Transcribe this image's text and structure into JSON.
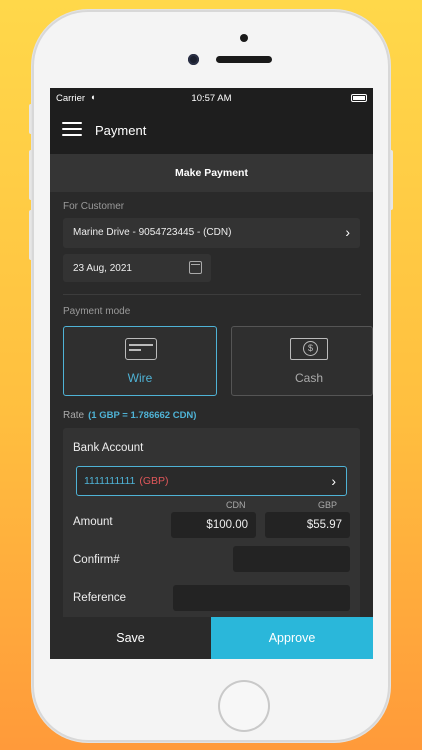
{
  "status_bar": {
    "carrier": "Carrier",
    "time": "10:57 AM"
  },
  "header": {
    "title": "Payment"
  },
  "subheader": {
    "title": "Make Payment"
  },
  "customer": {
    "label": "For Customer",
    "value": "Marine Drive - 9054723445 - (CDN)"
  },
  "date": {
    "value": "23 Aug, 2021"
  },
  "payment_mode": {
    "label": "Payment mode",
    "options": [
      {
        "label": "Wire",
        "selected": true
      },
      {
        "label": "Cash",
        "selected": false
      }
    ]
  },
  "rate": {
    "label": "Rate",
    "value": "(1 GBP = 1.786662 CDN)"
  },
  "bank": {
    "label": "Bank Account",
    "account_number": "1111111111",
    "account_currency": "(GBP)"
  },
  "amount": {
    "label": "Amount",
    "col_cdn": "CDN",
    "col_gbp": "GBP",
    "cdn_value": "$100.00",
    "gbp_value": "$55.97"
  },
  "confirm": {
    "label": "Confirm#",
    "value": ""
  },
  "reference": {
    "label": "Reference",
    "value": ""
  },
  "footer": {
    "save_label": "Save",
    "approve_label": "Approve"
  },
  "colors": {
    "accent": "#2ab7da",
    "currency": "#e0575a",
    "screen_bg": "#2a2a2a"
  }
}
